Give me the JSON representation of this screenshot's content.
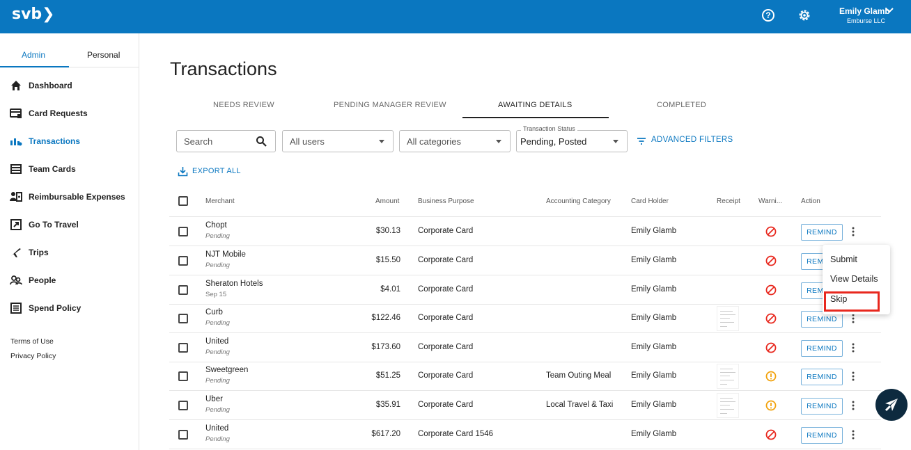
{
  "header": {
    "logo": "svb❯",
    "help_icon": "?",
    "user_name": "Emily Glamb",
    "user_org": "Emburse LLC"
  },
  "sidebar": {
    "tabs": [
      {
        "label": "Admin"
      },
      {
        "label": "Personal"
      }
    ],
    "items": [
      {
        "label": "Dashboard",
        "icon": "home-icon"
      },
      {
        "label": "Card Requests",
        "icon": "card-request-icon"
      },
      {
        "label": "Transactions",
        "icon": "transactions-icon"
      },
      {
        "label": "Team Cards",
        "icon": "team-cards-icon"
      },
      {
        "label": "Reimbursable Expenses",
        "icon": "reimbursable-icon"
      },
      {
        "label": "Go To Travel",
        "icon": "external-link-icon"
      },
      {
        "label": "Trips",
        "icon": "plane-icon"
      },
      {
        "label": "People",
        "icon": "people-icon"
      },
      {
        "label": "Spend Policy",
        "icon": "policy-icon"
      }
    ],
    "footer": {
      "terms": "Terms of Use",
      "privacy": "Privacy Policy"
    }
  },
  "page": {
    "title": "Transactions"
  },
  "tabs": [
    {
      "label": "NEEDS REVIEW"
    },
    {
      "label": "PENDING MANAGER REVIEW"
    },
    {
      "label": "AWAITING DETAILS"
    },
    {
      "label": "COMPLETED"
    }
  ],
  "filters": {
    "search_placeholder": "Search",
    "users": "All users",
    "categories": "All categories",
    "status_legend": "Transaction Status",
    "status_value": "Pending, Posted",
    "advanced": "ADVANCED FILTERS",
    "export": "EXPORT ALL"
  },
  "table": {
    "headers": {
      "merchant": "Merchant",
      "amount": "Amount",
      "purpose": "Business Purpose",
      "category": "Accounting Category",
      "holder": "Card Holder",
      "receipt": "Receipt",
      "warning": "Warni...",
      "action": "Action"
    },
    "rows": [
      {
        "merchant": "Chopt",
        "status": "Pending",
        "amount": "$30.13",
        "purpose": "Corporate Card",
        "category": "",
        "holder": "Emily Glamb",
        "receipt": false,
        "warning": "error",
        "action": "REMIND"
      },
      {
        "merchant": "NJT Mobile",
        "status": "Pending",
        "amount": "$15.50",
        "purpose": "Corporate Card",
        "category": "",
        "holder": "Emily Glamb",
        "receipt": false,
        "warning": "error",
        "action": "REMIND"
      },
      {
        "merchant": "Sheraton Hotels",
        "status": "Sep 15",
        "amount": "$4.01",
        "purpose": "Corporate Card",
        "category": "",
        "holder": "Emily Glamb",
        "receipt": false,
        "warning": "error",
        "action": "REMIND"
      },
      {
        "merchant": "Curb",
        "status": "Pending",
        "amount": "$122.46",
        "purpose": "Corporate Card",
        "category": "",
        "holder": "Emily Glamb",
        "receipt": true,
        "warning": "error",
        "action": "REMIND"
      },
      {
        "merchant": "United",
        "status": "Pending",
        "amount": "$173.60",
        "purpose": "Corporate Card",
        "category": "",
        "holder": "Emily Glamb",
        "receipt": false,
        "warning": "error",
        "action": "REMIND"
      },
      {
        "merchant": "Sweetgreen",
        "status": "Pending",
        "amount": "$51.25",
        "purpose": "Corporate Card",
        "category": "Team Outing Meal",
        "holder": "Emily Glamb",
        "receipt": true,
        "warning": "caution",
        "action": "REMIND"
      },
      {
        "merchant": "Uber",
        "status": "Pending",
        "amount": "$35.91",
        "purpose": "Corporate Card",
        "category": "Local Travel & Taxi",
        "holder": "Emily Glamb",
        "receipt": true,
        "warning": "caution",
        "action": "REMIND"
      },
      {
        "merchant": "United",
        "status": "Pending",
        "amount": "$617.20",
        "purpose": "Corporate Card 1546",
        "category": "",
        "holder": "Emily Glamb",
        "receipt": false,
        "warning": "error",
        "action": "REMIND"
      }
    ]
  },
  "menu": {
    "items": [
      {
        "label": "Submit"
      },
      {
        "label": "View Details"
      },
      {
        "label": "Skip"
      }
    ]
  },
  "colors": {
    "brand": "#0a77c0",
    "error": "#e8281e",
    "caution": "#f2a20c",
    "fab": "#0d2a3f"
  }
}
